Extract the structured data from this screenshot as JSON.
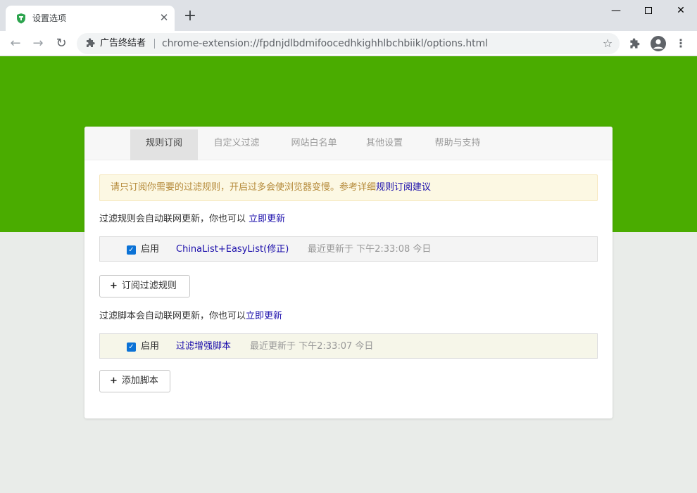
{
  "browser": {
    "tab_title": "设置选项",
    "tab_close": "✕",
    "new_tab": "+",
    "win_min": "—",
    "win_close": "✕",
    "nav_back": "←",
    "nav_forward": "→",
    "nav_reload": "↻",
    "extension_name": "广告终结者",
    "url": "chrome-extension://fpdnjdlbdmifoocedhkighhlbchbiikl/options.html",
    "star": "☆",
    "menu": "⋮",
    "icons": {
      "favicon": "shield-icon",
      "extension": "puzzle-icon",
      "profile": "avatar-icon"
    }
  },
  "options": {
    "tabs": [
      {
        "label": "规则订阅",
        "active": true
      },
      {
        "label": "自定义过滤"
      },
      {
        "label": "网站白名单"
      },
      {
        "label": "其他设置"
      },
      {
        "label": "帮助与支持"
      }
    ],
    "notice": {
      "text": "请只订阅你需要的过滤规则，开启过多会使浏览器变慢。参考详细",
      "link": "规则订阅建议"
    },
    "filter_rules": {
      "desc": "过滤规则会自动联网更新，你也可以 ",
      "update_link": "立即更新",
      "item": {
        "checked": true,
        "enable_label": "启用",
        "name": "ChinaList+EasyList(修正)",
        "updated": "最近更新于 下午2:33:08 今日"
      },
      "add_button": "订阅过滤规则"
    },
    "filter_scripts": {
      "desc": "过滤脚本会自动联网更新，你也可以",
      "update_link": "立即更新",
      "item": {
        "checked": true,
        "enable_label": "启用",
        "name": "过滤增强脚本",
        "updated": "最近更新于 下午2:33:07 今日"
      },
      "add_button": "添加脚本"
    }
  },
  "colors": {
    "header_green": "#4aac00",
    "page_bg": "#e9ece9",
    "link": "#1a0dab",
    "notice_text": "#b58a3a"
  }
}
